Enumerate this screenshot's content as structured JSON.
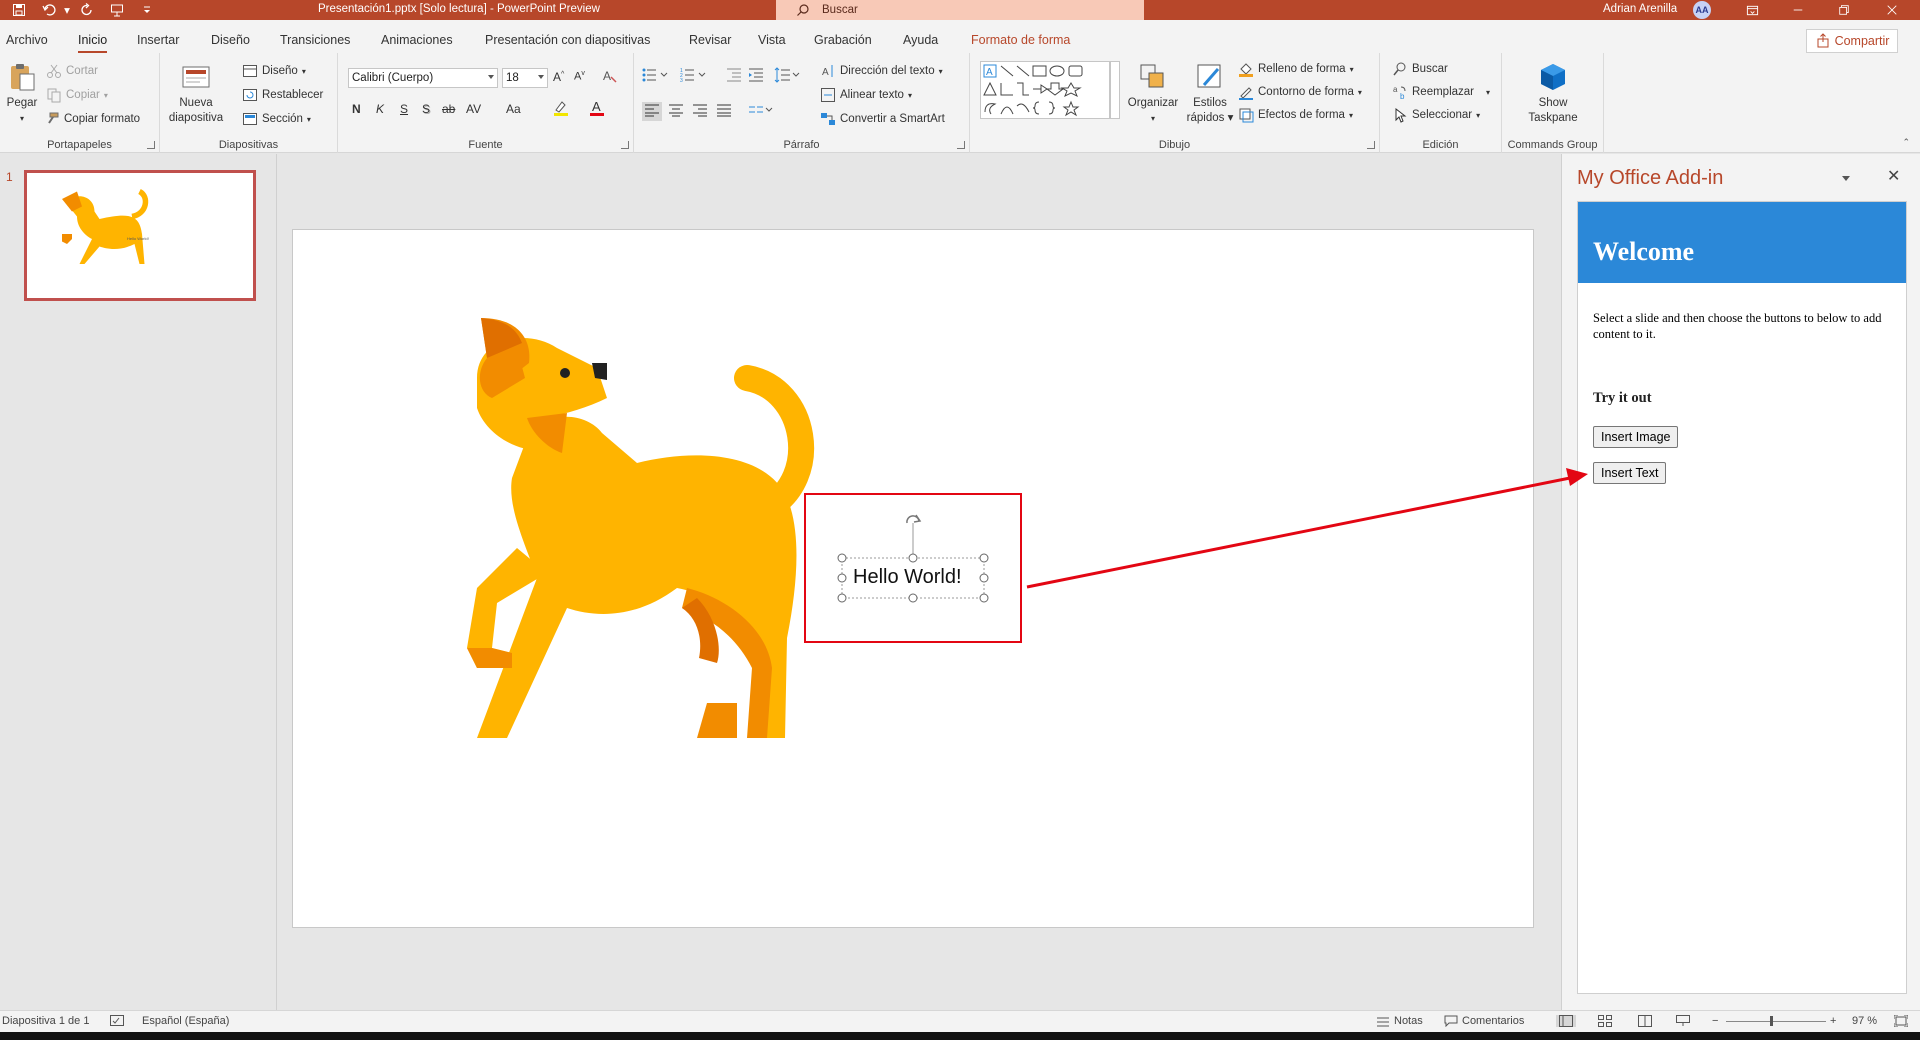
{
  "titlebar": {
    "doc_title": "Presentación1.pptx [Solo lectura]  -  PowerPoint Preview",
    "search_label": "Buscar",
    "user_name": "Adrian Arenilla",
    "user_initials": "AA"
  },
  "tabs": [
    {
      "label": "Archivo"
    },
    {
      "label": "Inicio"
    },
    {
      "label": "Insertar"
    },
    {
      "label": "Diseño"
    },
    {
      "label": "Transiciones"
    },
    {
      "label": "Animaciones"
    },
    {
      "label": "Presentación con diapositivas"
    },
    {
      "label": "Revisar"
    },
    {
      "label": "Vista"
    },
    {
      "label": "Grabación"
    },
    {
      "label": "Ayuda"
    },
    {
      "label": "Formato de forma"
    }
  ],
  "share_label": "Compartir",
  "ribbon": {
    "portapapeles": {
      "label": "Portapapeles",
      "paste": "Pegar",
      "cut": "Cortar",
      "copy": "Copiar",
      "format_painter": "Copiar formato"
    },
    "diapositivas": {
      "label": "Diapositivas",
      "new_slide_1": "Nueva",
      "new_slide_2": "diapositiva",
      "layout": "Diseño",
      "reset": "Restablecer",
      "section": "Sección"
    },
    "fuente": {
      "label": "Fuente",
      "font_name": "Calibri (Cuerpo)",
      "font_size": "18",
      "bold": "N",
      "italic": "K",
      "underline": "S",
      "shadow": "S",
      "strike": "ab",
      "spacing": "AV",
      "case": "Aa"
    },
    "parrafo": {
      "label": "Párrafo",
      "text_direction": "Dirección del texto",
      "align_text": "Alinear texto",
      "smartart": "Convertir a SmartArt"
    },
    "dibujo": {
      "label": "Dibujo",
      "arrange": "Organizar",
      "quick_styles_1": "Estilos",
      "quick_styles_2": "rápidos",
      "fill": "Relleno de forma",
      "outline": "Contorno de forma",
      "effects": "Efectos de forma"
    },
    "edicion": {
      "label": "Edición",
      "find": "Buscar",
      "replace": "Reemplazar",
      "select": "Seleccionar"
    },
    "commands": {
      "label": "Commands Group",
      "show_1": "Show",
      "show_2": "Taskpane"
    }
  },
  "thumbnail": {
    "number": "1",
    "caption": "Hello World!"
  },
  "slide": {
    "text": "Hello World!"
  },
  "taskpane": {
    "title": "My Office Add-in",
    "welcome": "Welcome",
    "instructions": "Select a slide and then choose the buttons to below to add content to it.",
    "try_it_out": "Try it out",
    "insert_image": "Insert Image",
    "insert_text": "Insert Text"
  },
  "statusbar": {
    "slide_info": "Diapositiva 1 de 1",
    "language": "Español (España)",
    "notes": "Notas",
    "comments": "Comentarios",
    "zoom": "97 %"
  },
  "colors": {
    "accent": "#b7472a",
    "header_blue": "#2b88d8",
    "highlight_red": "#e30613",
    "dog_yellow": "#ffb400"
  }
}
